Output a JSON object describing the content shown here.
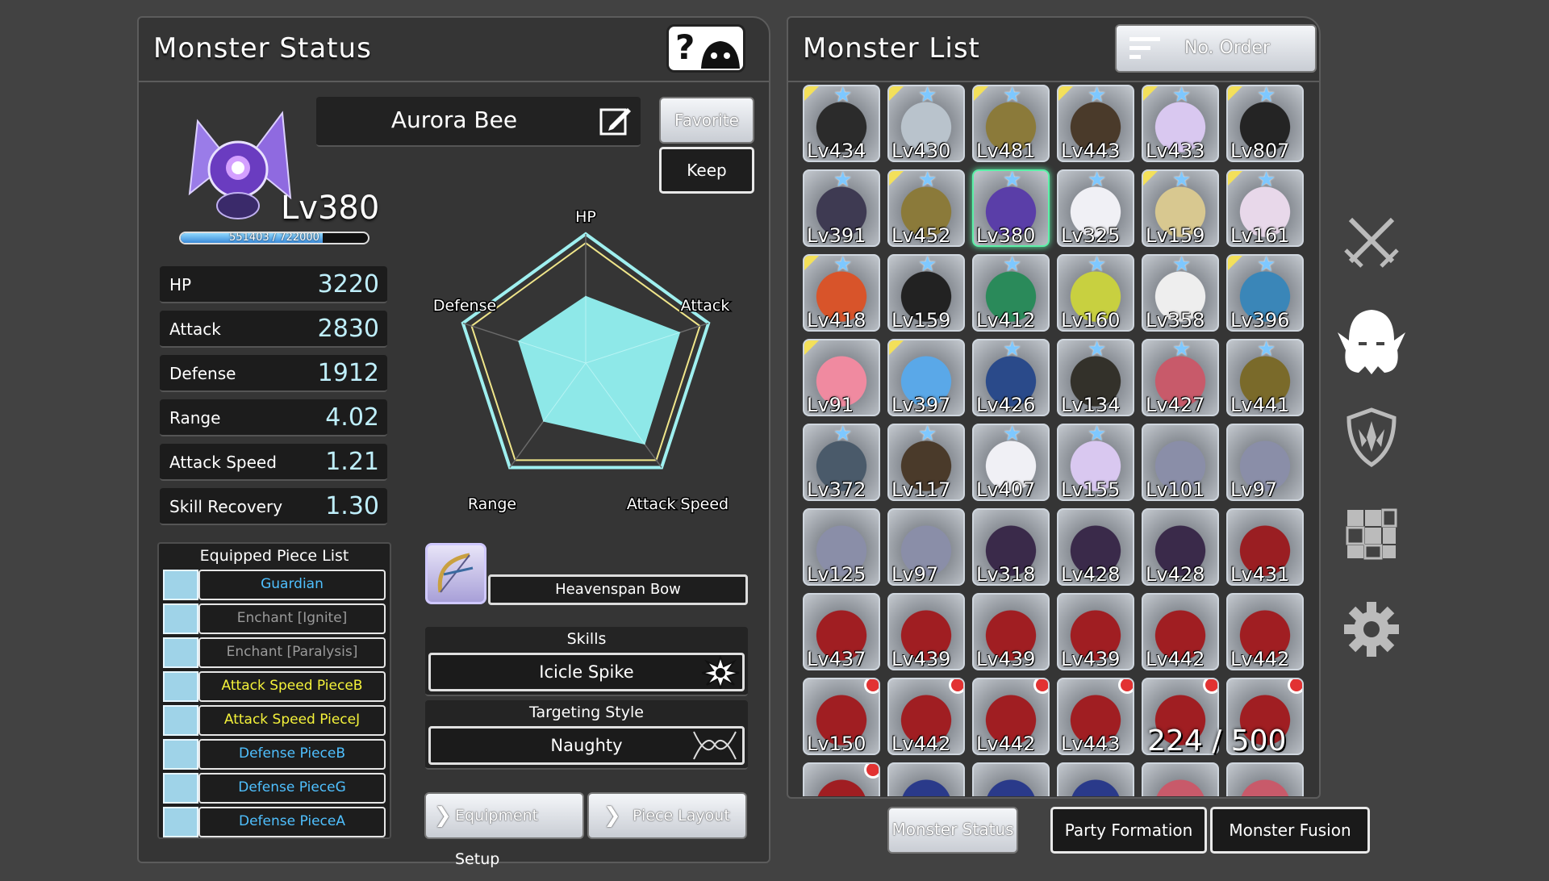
{
  "status_panel": {
    "title": "Monster Status",
    "monster_name": "Aurora Bee",
    "level": "Lv380",
    "exp_text": "551403 / 722000",
    "exp_fraction": 0.76,
    "favorite_label": "Favorite",
    "keep_label": "Keep",
    "stats": [
      {
        "label": "HP",
        "value": "3220"
      },
      {
        "label": "Attack",
        "value": "2830"
      },
      {
        "label": "Defense",
        "value": "1912"
      },
      {
        "label": "Range",
        "value": "4.02"
      },
      {
        "label": "Attack Speed",
        "value": "1.21"
      },
      {
        "label": "Skill Recovery",
        "value": "1.30"
      }
    ],
    "radar": {
      "labels": [
        "HP",
        "Attack",
        "Attack Speed",
        "Range",
        "Defense"
      ],
      "values": [
        0.52,
        0.77,
        0.78,
        0.56,
        0.55
      ],
      "fill_color": "#8ee8e8"
    },
    "pieces_title": "Equipped Piece List",
    "pieces": [
      {
        "name": "Guardian",
        "color": "#4fc0ff"
      },
      {
        "name": "Enchant [Ignite]",
        "color": "#9a9a9a"
      },
      {
        "name": "Enchant [Paralysis]",
        "color": "#9a9a9a"
      },
      {
        "name": "Attack Speed PieceB",
        "color": "#f4f23a"
      },
      {
        "name": "Attack Speed PieceJ",
        "color": "#f4f23a"
      },
      {
        "name": "Defense PieceB",
        "color": "#4fc0ff"
      },
      {
        "name": "Defense PieceG",
        "color": "#4fc0ff"
      },
      {
        "name": "Defense PieceA",
        "color": "#4fc0ff"
      }
    ],
    "weapon_name": "Heavenspan Bow",
    "skills_title": "Skills",
    "skill_name": "Icicle Spike",
    "targeting_title": "Targeting Style",
    "targeting_value": "Naughty",
    "equipment_setup_label": "Equipment Setup",
    "piece_layout_label": "Piece Layout"
  },
  "list_panel": {
    "title": "Monster List",
    "sort_label": "No. Order",
    "count_text": "224 / 500",
    "monsters": [
      {
        "lv": "Lv434",
        "color": "#2b2b2b",
        "star": true,
        "corner": true,
        "dot": false
      },
      {
        "lv": "Lv430",
        "color": "#b9c3cc",
        "star": true,
        "corner": true,
        "dot": false
      },
      {
        "lv": "Lv481",
        "color": "#8b7a3a",
        "star": true,
        "corner": true,
        "dot": false
      },
      {
        "lv": "Lv443",
        "color": "#4a3a2a",
        "star": true,
        "corner": true,
        "dot": false
      },
      {
        "lv": "Lv433",
        "color": "#d9c8f0",
        "star": true,
        "corner": true,
        "dot": false
      },
      {
        "lv": "Lv807",
        "color": "#242424",
        "star": true,
        "corner": true,
        "dot": false
      },
      {
        "lv": "Lv391",
        "color": "#3e3a52",
        "star": true,
        "corner": false,
        "dot": false
      },
      {
        "lv": "Lv452",
        "color": "#8b7a3a",
        "star": true,
        "corner": true,
        "dot": false
      },
      {
        "lv": "Lv380",
        "color": "#5a3ea8",
        "star": true,
        "corner": false,
        "dot": false
      },
      {
        "lv": "Lv325",
        "color": "#f0f0f5",
        "star": true,
        "corner": false,
        "dot": false
      },
      {
        "lv": "Lv159",
        "color": "#d8c890",
        "star": true,
        "corner": true,
        "dot": false
      },
      {
        "lv": "Lv161",
        "color": "#e8d8ea",
        "star": true,
        "corner": true,
        "dot": false
      },
      {
        "lv": "Lv418",
        "color": "#d8542a",
        "star": true,
        "corner": true,
        "dot": false
      },
      {
        "lv": "Lv159",
        "color": "#222222",
        "star": true,
        "corner": false,
        "dot": false
      },
      {
        "lv": "Lv412",
        "color": "#2a8a5a",
        "star": true,
        "corner": false,
        "dot": false
      },
      {
        "lv": "Lv160",
        "color": "#c8d040",
        "star": true,
        "corner": false,
        "dot": false
      },
      {
        "lv": "Lv358",
        "color": "#eeeeee",
        "star": true,
        "corner": false,
        "dot": false
      },
      {
        "lv": "Lv396",
        "color": "#3a86b8",
        "star": true,
        "corner": true,
        "dot": false
      },
      {
        "lv": "Lv91",
        "color": "#f08aa0",
        "star": false,
        "corner": true,
        "dot": false
      },
      {
        "lv": "Lv397",
        "color": "#5aa8e8",
        "star": false,
        "corner": true,
        "dot": false
      },
      {
        "lv": "Lv426",
        "color": "#2a4a8a",
        "star": true,
        "corner": false,
        "dot": false
      },
      {
        "lv": "Lv134",
        "color": "#33312a",
        "star": true,
        "corner": false,
        "dot": false
      },
      {
        "lv": "Lv427",
        "color": "#c85a6a",
        "star": true,
        "corner": false,
        "dot": false
      },
      {
        "lv": "Lv441",
        "color": "#7a6a2a",
        "star": true,
        "corner": false,
        "dot": false
      },
      {
        "lv": "Lv372",
        "color": "#4a5a6a",
        "star": true,
        "corner": false,
        "dot": false
      },
      {
        "lv": "Lv117",
        "color": "#4a3a2a",
        "star": true,
        "corner": false,
        "dot": false
      },
      {
        "lv": "Lv407",
        "color": "#f0f0f5",
        "star": true,
        "corner": false,
        "dot": false
      },
      {
        "lv": "Lv155",
        "color": "#d9c8f0",
        "star": true,
        "corner": false,
        "dot": false
      },
      {
        "lv": "Lv101",
        "color": "#8a8ea8",
        "star": false,
        "corner": false,
        "dot": false
      },
      {
        "lv": "Lv97",
        "color": "#8a8ea8",
        "star": false,
        "corner": false,
        "dot": false
      },
      {
        "lv": "Lv125",
        "color": "#8a8ea8",
        "star": false,
        "corner": false,
        "dot": false
      },
      {
        "lv": "Lv97",
        "color": "#8a8ea8",
        "star": false,
        "corner": false,
        "dot": false
      },
      {
        "lv": "Lv318",
        "color": "#3a2a4a",
        "star": false,
        "corner": false,
        "dot": false
      },
      {
        "lv": "Lv428",
        "color": "#3a2a4a",
        "star": false,
        "corner": false,
        "dot": false
      },
      {
        "lv": "Lv428",
        "color": "#3a2a4a",
        "star": false,
        "corner": false,
        "dot": false
      },
      {
        "lv": "Lv431",
        "color": "#9a1e22",
        "star": false,
        "corner": false,
        "dot": false
      },
      {
        "lv": "Lv437",
        "color": "#a01e22",
        "star": false,
        "corner": false,
        "dot": false
      },
      {
        "lv": "Lv439",
        "color": "#a01e22",
        "star": false,
        "corner": false,
        "dot": false
      },
      {
        "lv": "Lv439",
        "color": "#a01e22",
        "star": false,
        "corner": false,
        "dot": false
      },
      {
        "lv": "Lv439",
        "color": "#a01e22",
        "star": false,
        "corner": false,
        "dot": false
      },
      {
        "lv": "Lv442",
        "color": "#a01e22",
        "star": false,
        "corner": false,
        "dot": false
      },
      {
        "lv": "Lv442",
        "color": "#a01e22",
        "star": false,
        "corner": false,
        "dot": false
      },
      {
        "lv": "Lv150",
        "color": "#a01e22",
        "star": false,
        "corner": false,
        "dot": true
      },
      {
        "lv": "Lv442",
        "color": "#a01e22",
        "star": false,
        "corner": false,
        "dot": true
      },
      {
        "lv": "Lv442",
        "color": "#a01e22",
        "star": false,
        "corner": false,
        "dot": true
      },
      {
        "lv": "Lv443",
        "color": "#a01e22",
        "star": false,
        "corner": false,
        "dot": true
      },
      {
        "lv": "",
        "color": "#a01e22",
        "star": false,
        "corner": false,
        "dot": true
      },
      {
        "lv": "",
        "color": "#a01e22",
        "star": false,
        "corner": false,
        "dot": true
      },
      {
        "lv": "",
        "color": "#a01e22",
        "star": false,
        "corner": false,
        "dot": true
      },
      {
        "lv": "",
        "color": "#2a3a8a",
        "star": false,
        "corner": false,
        "dot": false
      },
      {
        "lv": "",
        "color": "#2a3a8a",
        "star": false,
        "corner": false,
        "dot": false
      },
      {
        "lv": "",
        "color": "#2a3a8a",
        "star": false,
        "corner": false,
        "dot": false
      },
      {
        "lv": "",
        "color": "#c85a6a",
        "star": false,
        "corner": false,
        "dot": false
      },
      {
        "lv": "",
        "color": "#c85a6a",
        "star": false,
        "corner": false,
        "dot": false
      }
    ]
  },
  "side_icons": [
    "crossed-swords-icon",
    "monster-icon",
    "shield-emblem-icon",
    "puzzle-piece-icon",
    "gear-icon"
  ],
  "bottom_tabs": [
    {
      "label": "Monster Status",
      "active": true
    },
    {
      "label": "Party Formation",
      "active": false
    },
    {
      "label": "Monster Fusion",
      "active": false
    }
  ]
}
